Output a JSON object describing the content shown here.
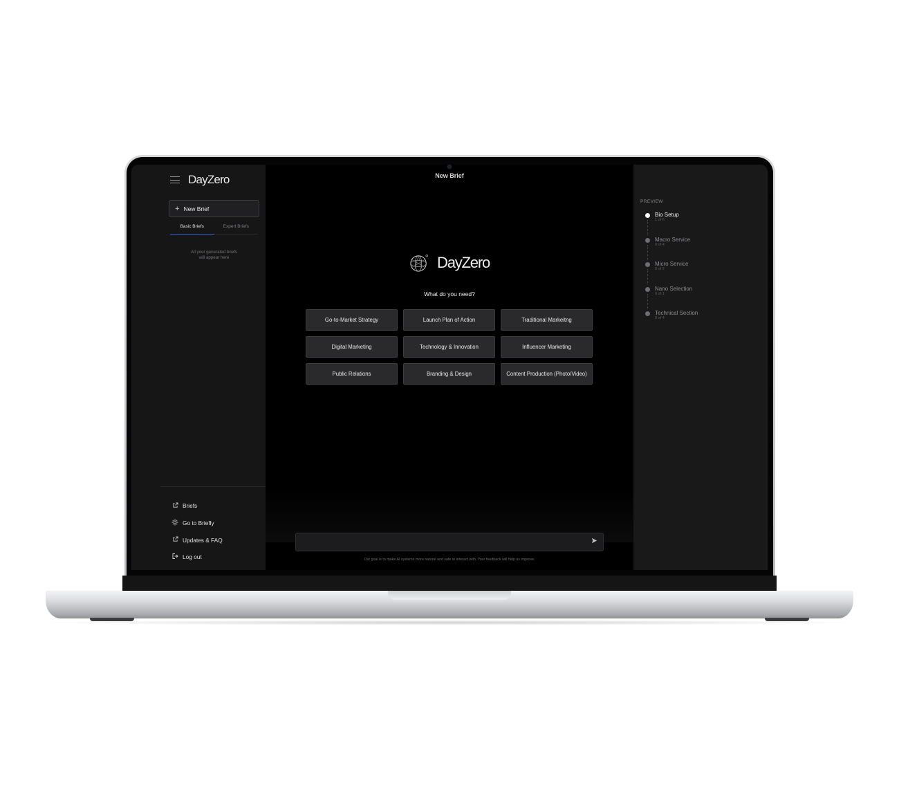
{
  "app": {
    "brand": "DayZero",
    "header_title": "New Brief"
  },
  "sidebar": {
    "new_brief_label": "New Brief",
    "tabs": [
      {
        "label": "Basic Briefs",
        "active": true
      },
      {
        "label": "Expert Briefs",
        "active": false
      }
    ],
    "empty_line1": "All your generated briefs",
    "empty_line2": "will appear here",
    "footer_links": [
      {
        "label": "Briefs",
        "icon": "external-link-icon"
      },
      {
        "label": "Go to Briefly",
        "icon": "sun-icon"
      },
      {
        "label": "Updates & FAQ",
        "icon": "external-link-icon"
      },
      {
        "label": "Log out",
        "icon": "logout-icon"
      }
    ]
  },
  "main": {
    "logo_text": "DayZero",
    "question": "What do you need?",
    "options": [
      "Go-to-Market Strategy",
      "Launch Plan of Action",
      "Traditional Markeitng",
      "Digital Marketing",
      "Technology & Innovation",
      "Influencer Marketing",
      "Public Relations",
      "Branding & Design",
      "Content Production (Photo/Video)"
    ],
    "input_placeholder": "",
    "disclaimer": "Our goal is to make AI systems more natural and safe to interact with. Your feedback will help us improve."
  },
  "preview": {
    "label": "PREVIEW",
    "steps": [
      {
        "name": "Bio Setup",
        "count": "1 of 6",
        "active": true
      },
      {
        "name": "Macro Service",
        "count": "0 of 4",
        "active": false
      },
      {
        "name": "Micro Service",
        "count": "0 of 2",
        "active": false
      },
      {
        "name": "Nano Selection",
        "count": "0 of 1",
        "active": false
      },
      {
        "name": "Technical Section",
        "count": "0 of 4",
        "active": false
      }
    ]
  },
  "colors": {
    "screen_bg": "#000000",
    "sidebar_bg": "#161617",
    "button_bg": "#2a2a2c",
    "tab_accent": "#3566d6"
  }
}
